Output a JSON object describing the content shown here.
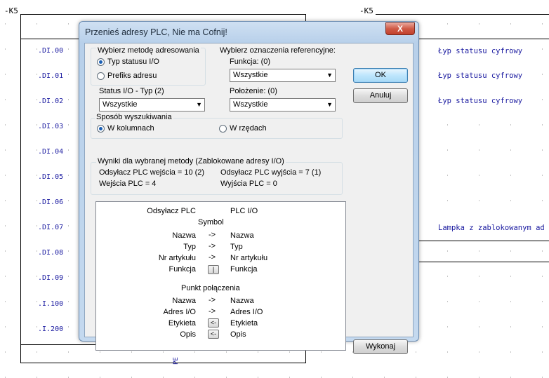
{
  "schematic": {
    "k_left": "-K5",
    "k_right": "-K5",
    "di_labels": [
      ".DI.00",
      ".DI.01",
      ".DI.02",
      ".DI.03",
      ".DI.04",
      ".DI.05",
      ".DI.06",
      ".DI.07",
      ".DI.08",
      ".DI.09",
      ".I.100",
      ".I.200"
    ],
    "right_texts": [
      "Łyp statusu cyfrowy",
      "Łyp statusu cyfrowy",
      "Łyp statusu cyfrowy",
      "Lampka z zablokowanym ad"
    ],
    "pe_label": "PE"
  },
  "dialog": {
    "title": "Przenieś adresy PLC, Nie ma Cofnij!",
    "close_label": "X",
    "method_group_label": "Wybierz metodę adresowania",
    "method_options": [
      "Typ statusu I/O",
      "Prefiks adresu"
    ],
    "method_selected": "Typ statusu I/O",
    "ref_group_label": "Wybierz oznaczenia referencyjne:",
    "function_label": "Funkcja: (0)",
    "function_value": "Wszystkie",
    "status_type_label": "Status I/O - Typ (2)",
    "status_type_value": "Wszystkie",
    "position_label": "Położenie: (0)",
    "position_value": "Wszystkie",
    "search_group_label": "Sposób wyszukiwania",
    "search_options": [
      "W kolumnach",
      "W rzędach"
    ],
    "search_selected": "W kolumnach",
    "results_label": "Wyniki dla wybranej metody (Zablokowane adresy I/O)",
    "results": {
      "plc_in_ref": "Odsyłacz PLC wejścia = 10 (2)",
      "plc_out_ref": "Odsyłacz PLC wyjścia = 7 (1)",
      "plc_inputs": "Wejścia PLC = 4",
      "plc_outputs": "Wyjścia PLC = 0"
    },
    "ok_label": "OK",
    "cancel_label": "Anuluj",
    "execute_label": "Wykonaj",
    "mapping": {
      "col_left": "Odsyłacz PLC",
      "col_right": "PLC I/O",
      "symbol_header": "Symbol",
      "symbol_rows": [
        {
          "left": "Nazwa",
          "op": "->",
          "right": "Nazwa"
        },
        {
          "left": "Typ",
          "op": "->",
          "right": "Typ"
        },
        {
          "left": "Nr artykułu",
          "op": "->",
          "right": "Nr artykułu"
        },
        {
          "left": "Funkcja",
          "op": "|",
          "right": "Funkcja"
        }
      ],
      "connection_header": "Punkt połączenia",
      "connection_rows": [
        {
          "left": "Nazwa",
          "op": "->",
          "right": "Nazwa"
        },
        {
          "left": "Adres I/O",
          "op": "->",
          "right": "Adres I/O"
        },
        {
          "left": "Etykieta",
          "op": "<-",
          "right": "Etykieta"
        },
        {
          "left": "Opis",
          "op": "<-",
          "right": "Opis"
        }
      ]
    }
  }
}
